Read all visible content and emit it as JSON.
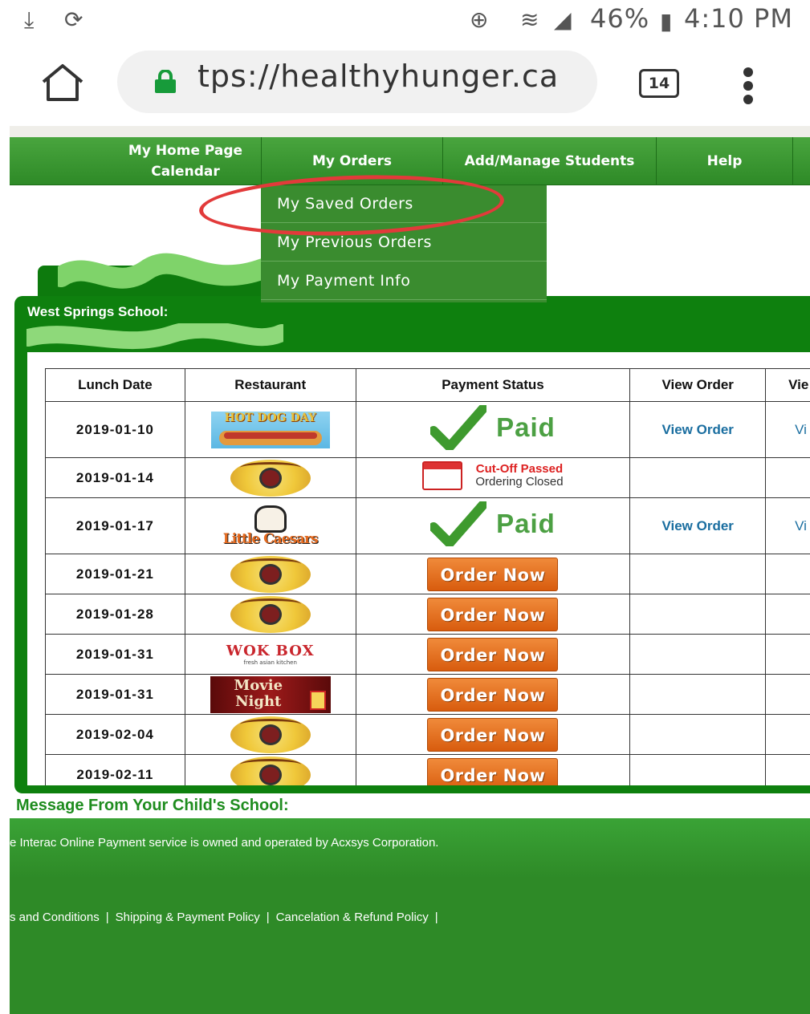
{
  "status_bar": {
    "battery": "46%",
    "time": "4:10 PM"
  },
  "browser": {
    "url": "tps://healthyhunger.ca",
    "tab_count": "14"
  },
  "nav": {
    "items": [
      {
        "label": "My Home Page Calendar"
      },
      {
        "label": "My Orders"
      },
      {
        "label": "Add/Manage Students"
      },
      {
        "label": "Help"
      }
    ],
    "dropdown": [
      "My Saved Orders",
      "My Previous Orders",
      "My Payment Info"
    ]
  },
  "panel": {
    "title": "West Springs School:"
  },
  "table": {
    "headers": [
      "Lunch Date",
      "Restaurant",
      "Payment Status",
      "View Order",
      "Vie"
    ],
    "rows": [
      {
        "date": "2019-01-10",
        "restaurant": "hotdog",
        "restaurant_text": "HOT DOG DAY",
        "status": "paid",
        "view": "View Order",
        "view2": "Vi"
      },
      {
        "date": "2019-01-14",
        "restaurant": "lunchlady",
        "status": "cutoff",
        "view": "",
        "view2": ""
      },
      {
        "date": "2019-01-17",
        "restaurant": "caesars",
        "restaurant_text": "Little Caesars",
        "status": "paid",
        "view": "View Order",
        "view2": "Vi"
      },
      {
        "date": "2019-01-21",
        "restaurant": "lunchlady",
        "status": "order",
        "view": "",
        "view2": ""
      },
      {
        "date": "2019-01-28",
        "restaurant": "lunchlady",
        "status": "order",
        "view": "",
        "view2": ""
      },
      {
        "date": "2019-01-31",
        "restaurant": "wokbox",
        "restaurant_text": "WOK BOX",
        "restaurant_sub": "fresh asian kitchen",
        "status": "order",
        "view": "",
        "view2": ""
      },
      {
        "date": "2019-01-31",
        "restaurant": "movie",
        "restaurant_text": "Movie Night",
        "status": "order",
        "view": "",
        "view2": ""
      },
      {
        "date": "2019-02-04",
        "restaurant": "lunchlady",
        "status": "order",
        "view": "",
        "view2": ""
      },
      {
        "date": "2019-02-11",
        "restaurant": "lunchlady",
        "status": "order",
        "view": "",
        "view2": ""
      }
    ],
    "labels": {
      "paid": "Paid",
      "cutoff_line1": "Cut-Off Passed",
      "cutoff_line2": "Ordering Closed",
      "order_now": "Order Now"
    }
  },
  "message_heading": "Message From Your Child's School:",
  "footer": {
    "notice": "e Interac Online Payment service is owned and operated by Acxsys Corporation.",
    "links": [
      "s and Conditions",
      "Shipping & Payment Policy",
      "Cancelation & Refund Policy"
    ]
  },
  "colors": {
    "nav_green": "#3a9a31",
    "panel_green": "#0e800e",
    "order_orange": "#e5701e",
    "link_blue": "#1a6ea0",
    "highlight_red": "#e23a3a"
  }
}
